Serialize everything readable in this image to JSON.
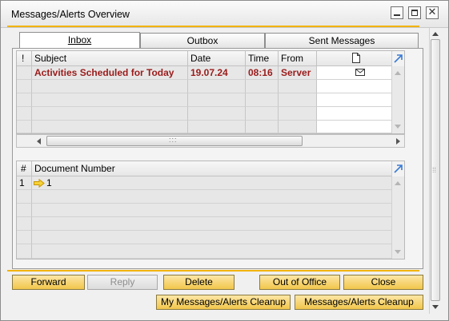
{
  "window": {
    "title": "Messages/Alerts Overview"
  },
  "tabs": [
    {
      "label": "Inbox",
      "active": true
    },
    {
      "label": "Outbox",
      "active": false
    },
    {
      "label": "Sent Messages",
      "active": false
    }
  ],
  "messages_grid": {
    "columns": [
      "!",
      "Subject",
      "Date",
      "Time",
      "From"
    ],
    "rows": [
      {
        "priority": "",
        "subject": "Activities Scheduled for Today",
        "date": "19.07.24",
        "time": "08:16",
        "from": "Server",
        "icon": "envelope-icon"
      }
    ]
  },
  "detail_grid": {
    "columns": [
      "#",
      "Document Number"
    ],
    "rows": [
      {
        "index": "1",
        "document_number": "1"
      }
    ]
  },
  "buttons": {
    "forward": "Forward",
    "reply": "Reply",
    "delete": "Delete",
    "out_of_office": "Out of Office",
    "close": "Close",
    "my_cleanup": "My Messages/Alerts Cleanup",
    "cleanup": "Messages/Alerts Cleanup"
  },
  "colors": {
    "accent": "#f2b300",
    "button": "#f1c64b",
    "subject_text": "#9b1b1b"
  }
}
